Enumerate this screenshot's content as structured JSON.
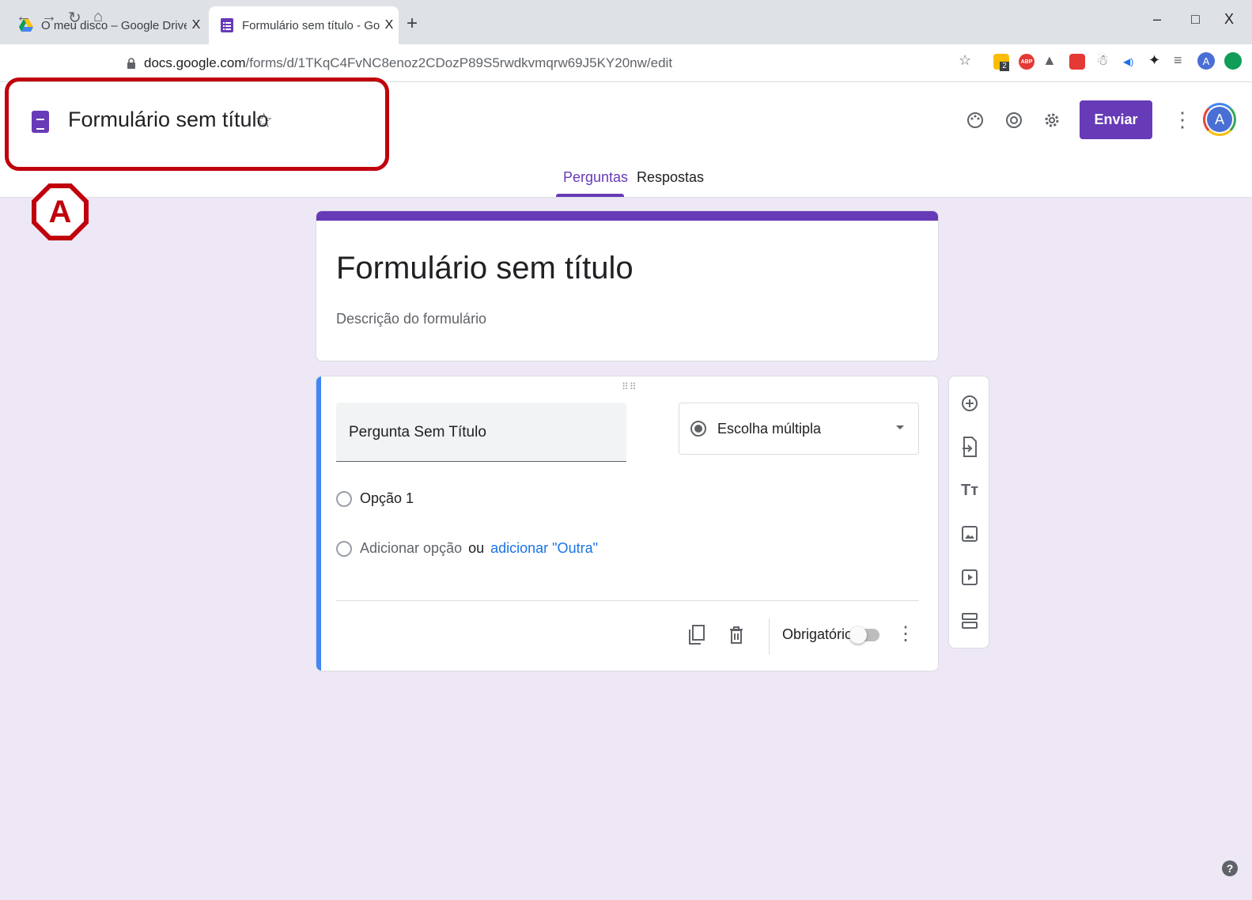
{
  "browser": {
    "tabs": [
      {
        "title": "O meu disco – Google Drive",
        "close": "X"
      },
      {
        "title": "Formulário sem título - Google Fo",
        "close": "X"
      }
    ],
    "new_tab": "+",
    "window_controls": {
      "minimize": "–",
      "maximize": "□",
      "close": "X"
    },
    "url_host": "docs.google.com",
    "url_path": "/forms/d/1TKqC4FvNC8enoz2CDozP89S5rwdkvmqrw69J5KY20nw/edit",
    "profile_initial": "A",
    "extension_badge": "2"
  },
  "header": {
    "doc_title": "Formulário sem título",
    "send_label": "Enviar",
    "avatar_initial": "A",
    "tabs": [
      {
        "label": "Perguntas",
        "active": true
      },
      {
        "label": "Respostas",
        "active": false
      }
    ]
  },
  "annotation": {
    "label": "A",
    "color": "#c0000c"
  },
  "form": {
    "title": "Formulário sem título",
    "description": "Descrição do formulário"
  },
  "question": {
    "title": "Pergunta Sem Título",
    "type": "Escolha múltipla",
    "option_1": "Opção 1",
    "add_option": "Adicionar opção",
    "or": "ou",
    "add_other": "adicionar \"Outra\"",
    "required_label": "Obrigatório",
    "required": false
  },
  "theme": {
    "accent": "#673ab7",
    "question_bar": "#4285f4",
    "link": "#1a73e8"
  }
}
